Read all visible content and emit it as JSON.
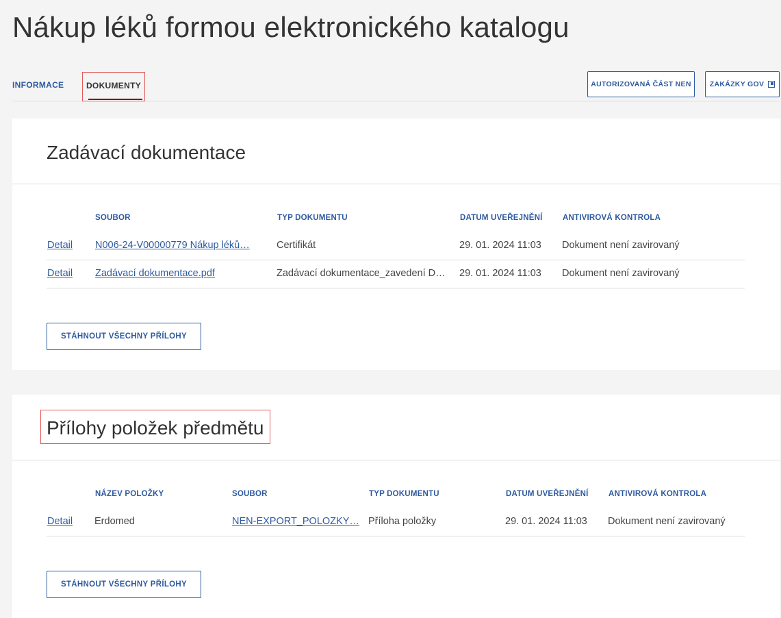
{
  "page": {
    "title": "Nákup léků formou elektronického katalogu"
  },
  "tabs": [
    {
      "label": "INFORMACE"
    },
    {
      "label": "DOKUMENTY"
    }
  ],
  "header_buttons": {
    "authorized": "AUTORIZOVANÁ ČÁST NEN",
    "gov": "ZAKÁZKY GOV"
  },
  "section1": {
    "title": "Zadávací dokumentace",
    "columns": [
      "SOUBOR",
      "TYP DOKUMENTU",
      "DATUM UVEŘEJNĚNÍ",
      "ANTIVIROVÁ KONTROLA"
    ],
    "rows": [
      {
        "detail": "Detail",
        "file": "N006-24-V00000779 Nákup léků…",
        "type": "Certifikát",
        "date": "29. 01. 2024 11:03",
        "av": "Dokument není zavirovaný"
      },
      {
        "detail": "Detail",
        "file": "Zadávací dokumentace.pdf",
        "type": "Zadávací dokumentace_zavedení D…",
        "date": "29. 01. 2024 11:03",
        "av": "Dokument není zavirovaný"
      }
    ],
    "download": "STÁHNOUT VŠECHNY PŘÍLOHY"
  },
  "section2": {
    "title": "Přílohy položek předmětu",
    "columns": [
      "NÁZEV POLOŽKY",
      "SOUBOR",
      "TYP DOKUMENTU",
      "DATUM UVEŘEJNĚNÍ",
      "ANTIVIROVÁ KONTROLA"
    ],
    "rows": [
      {
        "detail": "Detail",
        "item": "Erdomed",
        "file": "NEN-EXPORT_POLOZKY…",
        "type": "Příloha položky",
        "date": "29. 01. 2024 11:03",
        "av": "Dokument není zavirovaný"
      }
    ],
    "download": "STÁHNOUT VŠECHNY PŘÍLOHY"
  },
  "colors": {
    "accent": "#2e5aa0",
    "highlight": "#e05a5a",
    "tab_underline": "#7a1c1c"
  }
}
